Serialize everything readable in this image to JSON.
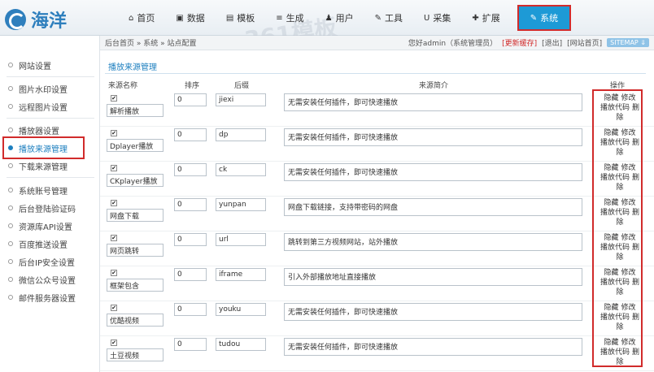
{
  "logo": {
    "text": "海洋"
  },
  "nav": [
    {
      "label": "首页",
      "icon": "home-icon",
      "glyph": "⌂"
    },
    {
      "label": "数据",
      "icon": "database-icon",
      "glyph": "▣"
    },
    {
      "label": "模板",
      "icon": "template-icon",
      "glyph": "▤"
    },
    {
      "label": "生成",
      "icon": "generate-icon",
      "glyph": "≡"
    },
    {
      "label": "用户",
      "icon": "user-icon",
      "glyph": "♟"
    },
    {
      "label": "工具",
      "icon": "wrench-icon",
      "glyph": "✎"
    },
    {
      "label": "采集",
      "icon": "magnet-icon",
      "glyph": "U"
    },
    {
      "label": "扩展",
      "icon": "puzzle-icon",
      "glyph": "✚"
    },
    {
      "label": "系统",
      "icon": "edit-icon",
      "glyph": "✎"
    }
  ],
  "breadcrumb": "后台首页 » 系统 » 站点配置",
  "header_right": {
    "greeting": "您好admin（系统管理员）",
    "refresh": "[更新缓存]",
    "logout": "[退出]",
    "site_home": "[网站首页]",
    "sitemap": "SITEMAP ⇓"
  },
  "watermark": "361模板",
  "sidebar": [
    {
      "label": "网站设置"
    },
    {
      "label": "图片水印设置"
    },
    {
      "label": "远程图片设置"
    },
    {
      "label": "播放器设置"
    },
    {
      "label": "播放来源管理"
    },
    {
      "label": "下载来源管理"
    },
    {
      "label": "系统账号管理"
    },
    {
      "label": "后台登陆验证码"
    },
    {
      "label": "资源库API设置"
    },
    {
      "label": "百度推送设置"
    },
    {
      "label": "后台IP安全设置"
    },
    {
      "label": "微信公众号设置"
    },
    {
      "label": "邮件服务器设置"
    }
  ],
  "section_title": "播放来源管理",
  "columns": {
    "name": "来源名称",
    "sort": "排序",
    "suffix": "后缀",
    "desc": "来源简介",
    "ops": "操作"
  },
  "rows": [
    {
      "checkmark": "✔",
      "name": "解析播放",
      "sort": "0",
      "suffix": "jiexi",
      "desc": "无需安装任何插件，即可快速播放"
    },
    {
      "checkmark": "✔",
      "name": "Dplayer播放",
      "sort": "0",
      "suffix": "dp",
      "desc": "无需安装任何插件，即可快速播放"
    },
    {
      "checkmark": "✔",
      "name": "CKplayer播放",
      "sort": "0",
      "suffix": "ck",
      "desc": "无需安装任何插件，即可快速播放"
    },
    {
      "checkmark": "✔",
      "name": "网盘下载",
      "sort": "0",
      "suffix": "yunpan",
      "desc": "网盘下载链接，支持带密码的网盘"
    },
    {
      "checkmark": "✔",
      "name": "网页跳转",
      "sort": "0",
      "suffix": "url",
      "desc": "跳转到第三方视频网站，站外播放"
    },
    {
      "checkmark": "✔",
      "name": "框架包含",
      "sort": "0",
      "suffix": "iframe",
      "desc": "引入外部播放地址直接播放"
    },
    {
      "checkmark": "✔",
      "name": "优酷视频",
      "sort": "0",
      "suffix": "youku",
      "desc": "无需安装任何插件，即可快速播放"
    },
    {
      "checkmark": "✔",
      "name": "土豆视频",
      "sort": "0",
      "suffix": "tudou",
      "desc": "无需安装任何插件，即可快速播放"
    }
  ],
  "ops": {
    "hide": "隐藏",
    "edit": "修改",
    "code": "播放代码",
    "delete": "删除"
  }
}
